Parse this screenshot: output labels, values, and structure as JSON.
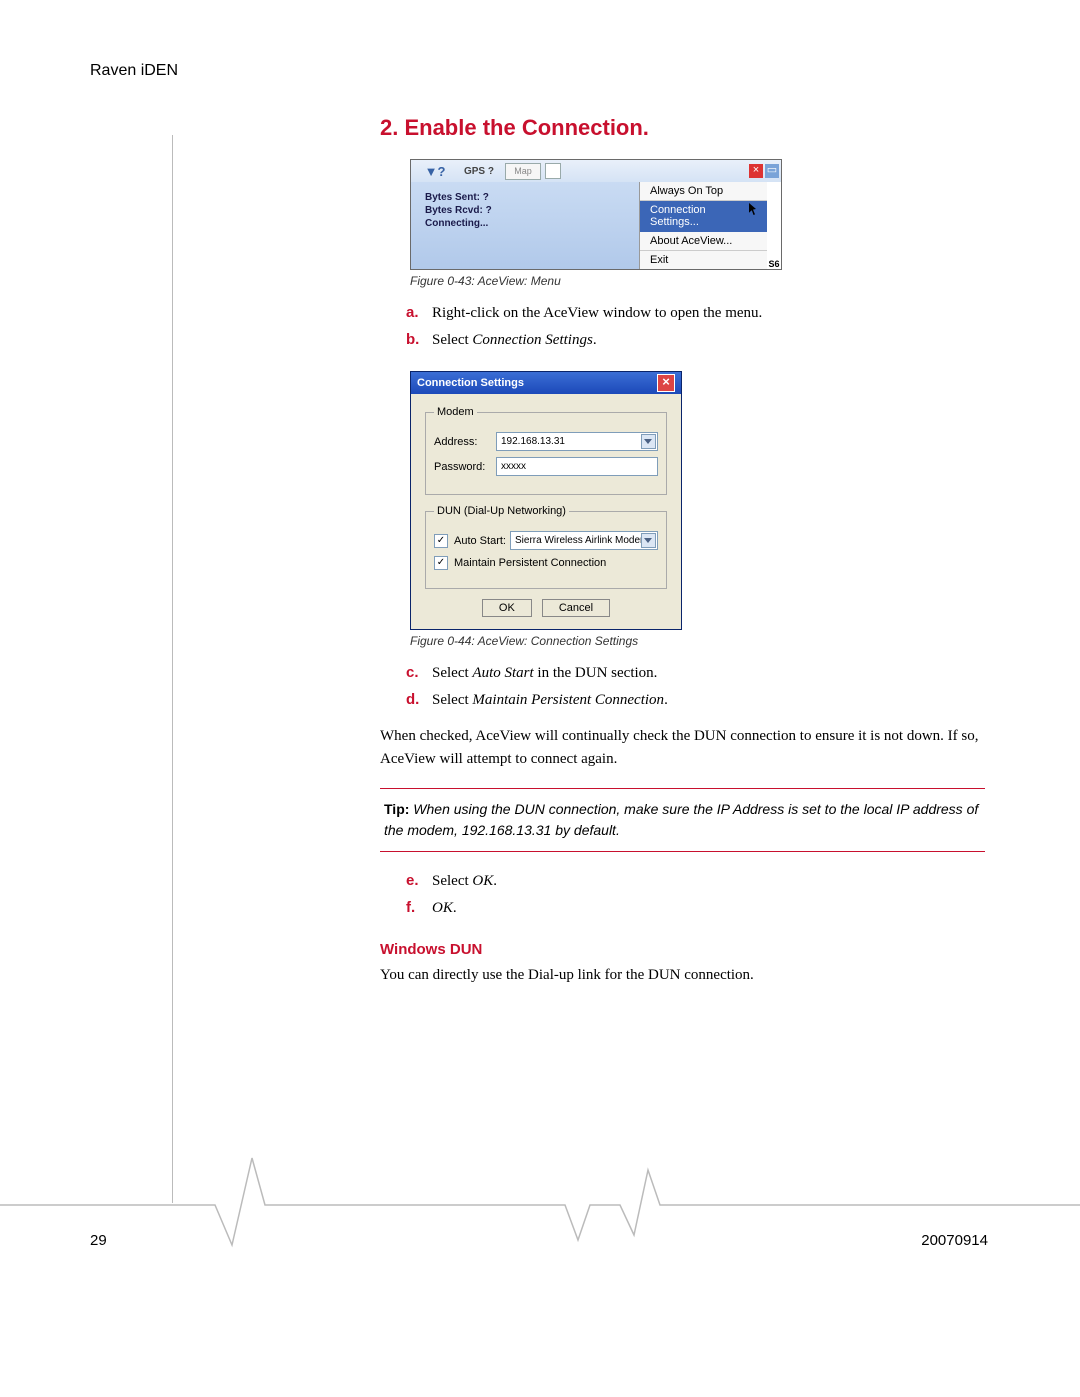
{
  "header": {
    "title": "Raven iDEN"
  },
  "section": {
    "heading": "2. Enable the Connection."
  },
  "fig43": {
    "caption": "Figure 0-43:  AceView: Menu",
    "signal_icon": "▼?",
    "gps_label": "GPS ?",
    "map_button": "Map",
    "bytes_sent": "Bytes Sent: ?",
    "bytes_rcvd": "Bytes Rcvd: ?",
    "connecting": "Connecting...",
    "menu": {
      "always_on_top": "Always On Top",
      "connection_settings": "Connection Settings...",
      "about": "About AceView...",
      "exit": "Exit"
    },
    "right_badge": "S6"
  },
  "steps1": {
    "a": "Right-click on the AceView window to open the menu.",
    "b_prefix": "Select ",
    "b_ital": "Connection Settings",
    "b_suffix": "."
  },
  "fig44": {
    "caption": "Figure 0-44:  AceView: Connection Settings",
    "title": "Connection Settings",
    "modem_legend": "Modem",
    "address_label": "Address:",
    "address_value": "192.168.13.31",
    "password_label": "Password:",
    "password_value": "xxxxx",
    "dun_legend": "DUN (Dial-Up Networking)",
    "auto_start_label": "Auto Start:",
    "auto_start_value": "Sierra Wireless Airlink Modem",
    "maintain_label": "Maintain Persistent Connection",
    "ok": "OK",
    "cancel": "Cancel",
    "check": "✓"
  },
  "steps2": {
    "c_prefix": "Select ",
    "c_ital": "Auto Start",
    "c_suffix": " in the DUN section.",
    "d_prefix": "Select ",
    "d_ital": "Maintain Persistent Connection",
    "d_suffix": "."
  },
  "para_check": "When checked, AceView will continually check the DUN connection to ensure it is not down. If so, AceView will attempt to connect again.",
  "tip": {
    "label": "Tip: ",
    "text": "When using the DUN connection, make sure the IP Address is set to the local IP address of the modem, 192.168.13.31 by default."
  },
  "steps3": {
    "e_prefix": "Select ",
    "e_ital": "OK",
    "e_suffix": ".",
    "f_ital": "OK",
    "f_suffix": "."
  },
  "sub": {
    "windows_dun": "Windows DUN"
  },
  "para_dun": "You can directly use the Dial-up link for the DUN connection.",
  "footer": {
    "page": "29",
    "date": "20070914"
  }
}
